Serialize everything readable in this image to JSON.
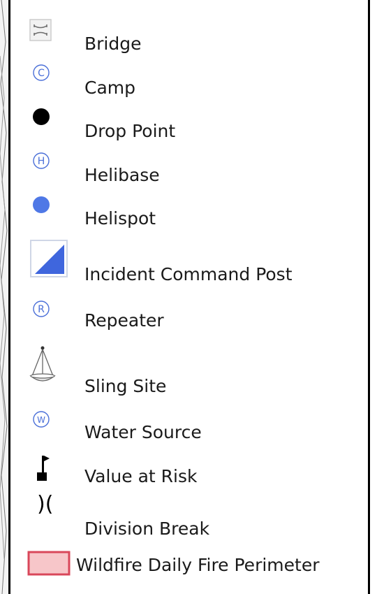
{
  "legend": {
    "items": [
      {
        "label": "Bridge",
        "icon": "bridge-icon"
      },
      {
        "label": "Camp",
        "icon": "camp-icon"
      },
      {
        "label": "Drop Point",
        "icon": "drop-point-icon"
      },
      {
        "label": "Helibase",
        "icon": "helibase-icon"
      },
      {
        "label": "Helispot",
        "icon": "helispot-icon"
      },
      {
        "label": "Incident Command Post",
        "icon": "incident-command-post-icon"
      },
      {
        "label": "Repeater",
        "icon": "repeater-icon"
      },
      {
        "label": "Sling Site",
        "icon": "sling-site-icon"
      },
      {
        "label": "Water Source",
        "icon": "water-source-icon"
      },
      {
        "label": "Value at Risk",
        "icon": "value-at-risk-icon"
      },
      {
        "label": "Division Break",
        "icon": "division-break-icon"
      },
      {
        "label": "Wildfire Daily Fire Perimeter",
        "icon": "fire-perimeter-icon"
      }
    ],
    "glyphs": {
      "camp": "C",
      "helibase": "H",
      "repeater": "R",
      "water_source": "W",
      "division_break": ")("
    },
    "colors": {
      "symbol_blue": "#4a6fd8",
      "helispot_fill": "#4f78e6",
      "icp_blue": "#3f66dd",
      "perimeter_fill": "#f7c6c9",
      "perimeter_stroke": "#d9475a",
      "panel_border": "#000000"
    }
  }
}
